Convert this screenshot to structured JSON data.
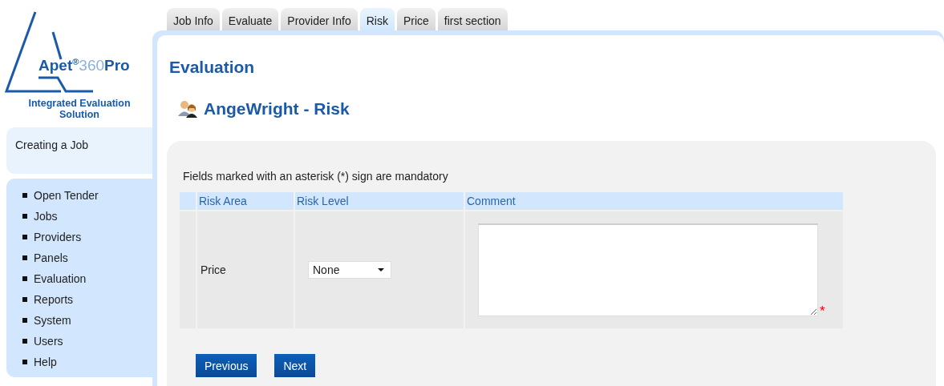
{
  "logo": {
    "brand": "Apet",
    "mark": "®",
    "number": "360",
    "suffix": "Pro",
    "tagline": "Integrated Evaluation Solution"
  },
  "sidebar": {
    "context": "Creating a Job",
    "items": [
      {
        "label": "Open Tender"
      },
      {
        "label": "Jobs"
      },
      {
        "label": "Providers"
      },
      {
        "label": "Panels"
      },
      {
        "label": "Evaluation"
      },
      {
        "label": "Reports"
      },
      {
        "label": "System"
      },
      {
        "label": "Users"
      },
      {
        "label": "Help"
      }
    ]
  },
  "tabs": [
    {
      "label": "Job Info",
      "selected": false
    },
    {
      "label": "Evaluate",
      "selected": false
    },
    {
      "label": "Provider Info",
      "selected": false
    },
    {
      "label": "Risk",
      "selected": true
    },
    {
      "label": "Price",
      "selected": false
    },
    {
      "label": "first section",
      "selected": false
    }
  ],
  "page": {
    "title": "Evaluation",
    "subtitle": "AngeWright - Risk",
    "note": "Fields marked with an asterisk (*) sign are mandatory"
  },
  "table": {
    "columns": [
      "Risk Area",
      "Risk Level",
      "Comment"
    ],
    "rows": [
      {
        "area": "Price",
        "level": "None",
        "comment": "",
        "required_mark": "*"
      }
    ]
  },
  "buttons": [
    "Previous",
    "Next"
  ]
}
